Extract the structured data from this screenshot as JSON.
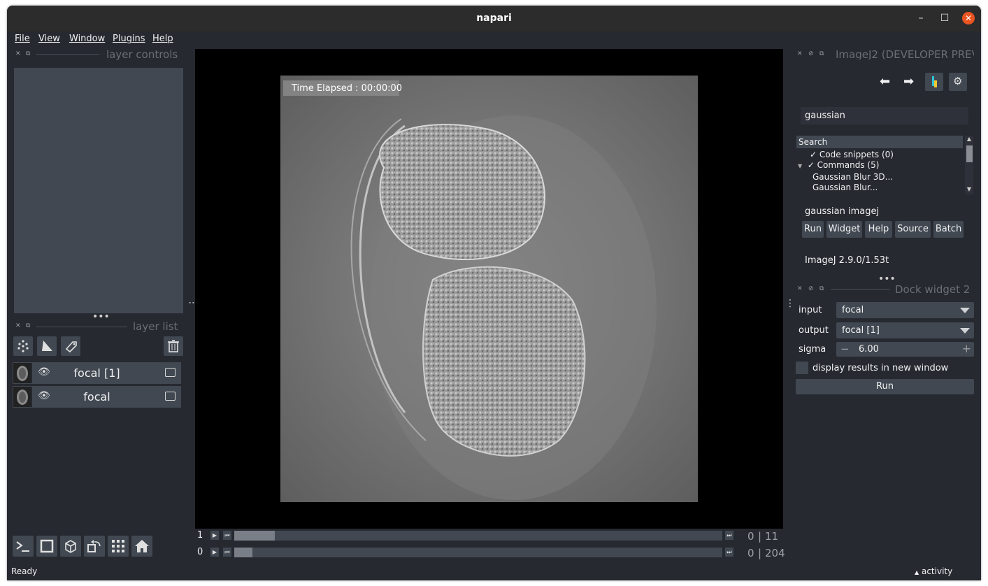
{
  "window": {
    "title": "napari"
  },
  "menu": [
    "File",
    "View",
    "Window",
    "Plugins",
    "Help"
  ],
  "left_dock": {
    "layer_controls_title": "layer controls",
    "layer_list_title": "layer list",
    "layers": [
      {
        "name": "focal [1]"
      },
      {
        "name": "focal"
      }
    ]
  },
  "canvas": {
    "overlay_text": "Time Elapsed : 00:00:00"
  },
  "dims": [
    {
      "label": "1",
      "value": "0",
      "max": "11",
      "position_fraction": 0.08
    },
    {
      "label": "0",
      "value": "0",
      "max": "204",
      "position_fraction": 0.0
    }
  ],
  "right_dock": {
    "imagej_title": "ImageJ2 (DEVELOPER PREV",
    "search_value": "gaussian",
    "search_header": "Search",
    "tree": {
      "code_snippets": "Code snippets (0)",
      "commands": "Commands (5)",
      "items": [
        "Gaussian Blur 3D...",
        "Gaussian Blur..."
      ]
    },
    "selected_command": "gaussian imagej",
    "action_buttons": [
      "Run",
      "Widget",
      "Help",
      "Source",
      "Batch"
    ],
    "version": "ImageJ 2.9.0/1.53t",
    "dock2_title": "Dock widget 2",
    "form": {
      "input_label": "input",
      "input_value": "focal",
      "output_label": "output",
      "output_value": "focal [1]",
      "sigma_label": "sigma",
      "sigma_value": "6.00",
      "checkbox_label": "display results in new window",
      "run_label": "Run"
    }
  },
  "status": {
    "text": "Ready",
    "activity": "activity"
  },
  "colors": {
    "bg": "#262930",
    "panel": "#414851",
    "close": "#e95420"
  }
}
